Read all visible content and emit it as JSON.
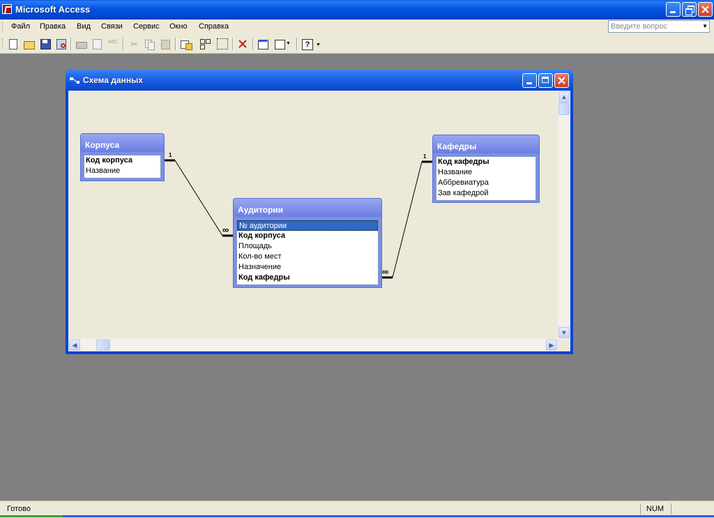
{
  "app": {
    "title": "Microsoft Access"
  },
  "menu": {
    "items": [
      {
        "label": "Файл"
      },
      {
        "label": "Правка"
      },
      {
        "label": "Вид"
      },
      {
        "label": "Связи"
      },
      {
        "label": "Сервис"
      },
      {
        "label": "Окно"
      },
      {
        "label": "Справка"
      }
    ],
    "question_placeholder": "Введите вопрос"
  },
  "toolbar": {
    "icons": [
      "new-file-icon",
      "open-folder-icon",
      "save-icon",
      "file-search-icon",
      "print-icon",
      "print-preview-icon",
      "spelling-icon",
      "cut-icon",
      "copy-icon",
      "paste-icon",
      "show-table-icon",
      "show-direct-icon",
      "show-all-icon",
      "delete-icon",
      "new-object-icon",
      "database-window-icon",
      "help-icon"
    ]
  },
  "child_window": {
    "title": "Схема данных",
    "tables": [
      {
        "name": "Корпуса",
        "fields": [
          {
            "label": "Код корпуса",
            "key": true
          },
          {
            "label": "Название",
            "key": false
          }
        ]
      },
      {
        "name": "Кафедры",
        "fields": [
          {
            "label": "Код кафедры",
            "key": true
          },
          {
            "label": "Название",
            "key": false
          },
          {
            "label": "Аббревиатура",
            "key": false
          },
          {
            "label": "Зав кафедрой",
            "key": false
          }
        ]
      },
      {
        "name": "Аудитории",
        "fields": [
          {
            "label": "№ аудитории",
            "key": false,
            "selected": true
          },
          {
            "label": "Код корпуса",
            "key": true
          },
          {
            "label": "Площадь",
            "key": false
          },
          {
            "label": "Кол-во мест",
            "key": false
          },
          {
            "label": "Назначение",
            "key": false
          },
          {
            "label": "Код кафедры",
            "key": true
          }
        ]
      }
    ],
    "relations": [
      {
        "from": "Корпуса",
        "to": "Аудитории",
        "from_label": "1",
        "to_label": "∞"
      },
      {
        "from": "Кафедры",
        "to": "Аудитории",
        "from_label": "1",
        "to_label": "∞"
      }
    ]
  },
  "status": {
    "left": "Готово",
    "num": "NUM"
  }
}
